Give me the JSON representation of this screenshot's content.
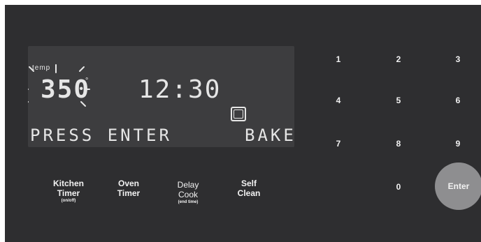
{
  "display": {
    "temp_label": "temp",
    "temperature": "350",
    "degree_symbol": "°",
    "clock": "12:30",
    "status_text": "PRESS ENTER",
    "mode_text": "BAKE",
    "oven_icon": "oven-icon"
  },
  "function_keys": {
    "kitchen_timer": {
      "line1": "Kitchen",
      "line2": "Timer",
      "sub": "(on/off)"
    },
    "oven_timer": {
      "line1": "Oven",
      "line2": "Timer"
    },
    "delay_cook": {
      "line1": "Delay",
      "line2": "Cook",
      "sub": "(end time)"
    },
    "self_clean": {
      "line1": "Self",
      "line2": "Clean"
    }
  },
  "keypad": {
    "k1": "1",
    "k2": "2",
    "k3": "3",
    "k4": "4",
    "k5": "5",
    "k6": "6",
    "k7": "7",
    "k8": "8",
    "k9": "9",
    "k0": "0",
    "enter": "Enter"
  },
  "colors": {
    "panel": "#2e2e30",
    "display": "#3d3d3f",
    "segment": "#e6e6e6",
    "enter_button": "#8e8e90"
  }
}
